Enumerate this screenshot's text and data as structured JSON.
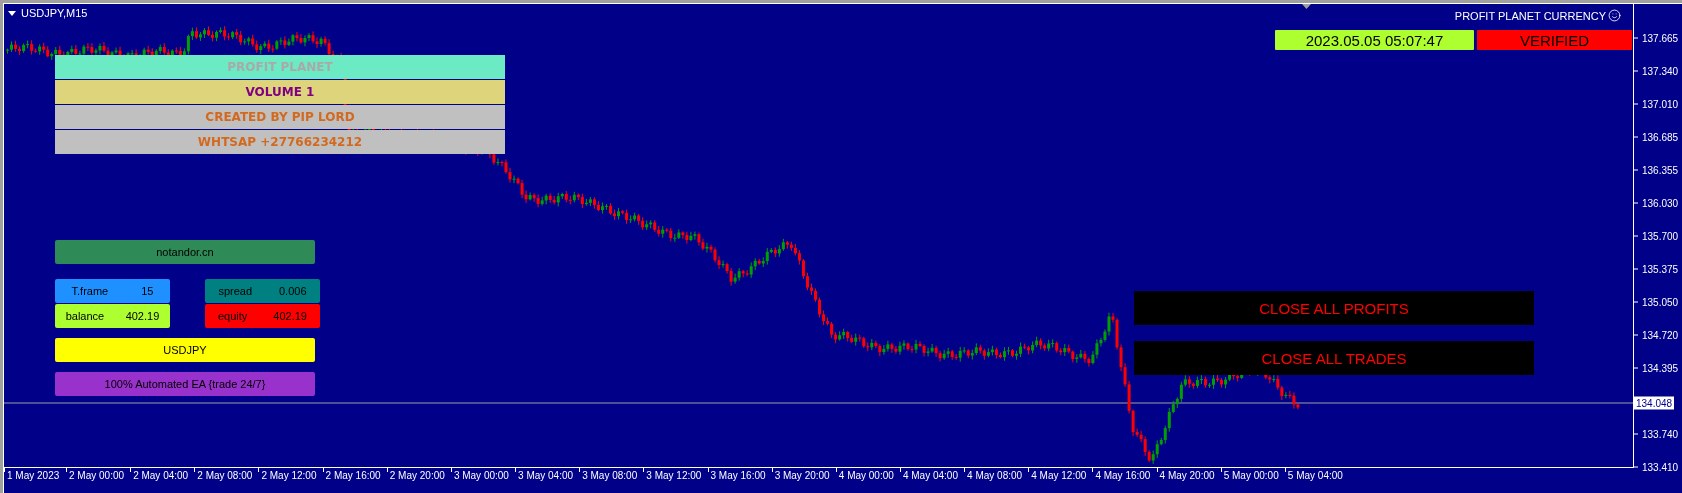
{
  "chart": {
    "symbol": "USDJPY,M15",
    "indicator": "PROFIT PLANET CURRENCY"
  },
  "banners": [
    {
      "text": "PROFIT PLANET",
      "kind": "title",
      "color": "#6ceac4"
    },
    {
      "text": "VOLUME 1",
      "kind": "subtitle",
      "color": "#ddd47c"
    },
    {
      "text": "CREATED BY PIP LORD",
      "kind": "credit",
      "color": "#c0c0c0"
    },
    {
      "text": "WHTSAP +27766234212",
      "kind": "credit",
      "color": "#c0c0c0"
    }
  ],
  "status": {
    "time": "2023.05.05 05:07:47",
    "verification": "VERIFIED"
  },
  "widgets": [
    {
      "kind": "wide",
      "label": "notandor.cn",
      "color": "#2e8b57"
    },
    {
      "kind": "pair",
      "label": "T.frame",
      "value": "15",
      "color": "#1e90ff"
    },
    {
      "kind": "pair",
      "label": "spread",
      "value": "0.006",
      "color": "#008080"
    },
    {
      "kind": "pair",
      "label": "balance",
      "value": "402.19",
      "color": "#adff2f"
    },
    {
      "kind": "pair",
      "label": "equity",
      "value": "402.19",
      "color": "#ff0000"
    },
    {
      "kind": "wide",
      "label": "USDJPY",
      "color": "#ffff00"
    },
    {
      "kind": "wide",
      "label": "100% Automated EA {trade 24/7}",
      "color": "#9932cc"
    }
  ],
  "buttons": [
    "CLOSE ALL PROFITS",
    "CLOSE ALL TRADES"
  ],
  "price_axis": {
    "ticks": [
      "137.665",
      "137.340",
      "137.010",
      "136.685",
      "136.355",
      "136.030",
      "135.700",
      "135.375",
      "135.050",
      "134.720",
      "134.395",
      "133.740",
      "133.410"
    ],
    "current_price": "134.048"
  },
  "time_axis": [
    "1 May 2023",
    "2 May 00:00",
    "2 May 04:00",
    "2 May 08:00",
    "2 May 12:00",
    "2 May 16:00",
    "2 May 20:00",
    "3 May 00:00",
    "3 May 04:00",
    "3 May 08:00",
    "3 May 12:00",
    "3 May 16:00",
    "3 May 20:00",
    "4 May 00:00",
    "4 May 04:00",
    "4 May 08:00",
    "4 May 12:00",
    "4 May 16:00",
    "4 May 20:00",
    "5 May 00:00",
    "5 May 04:00"
  ]
}
